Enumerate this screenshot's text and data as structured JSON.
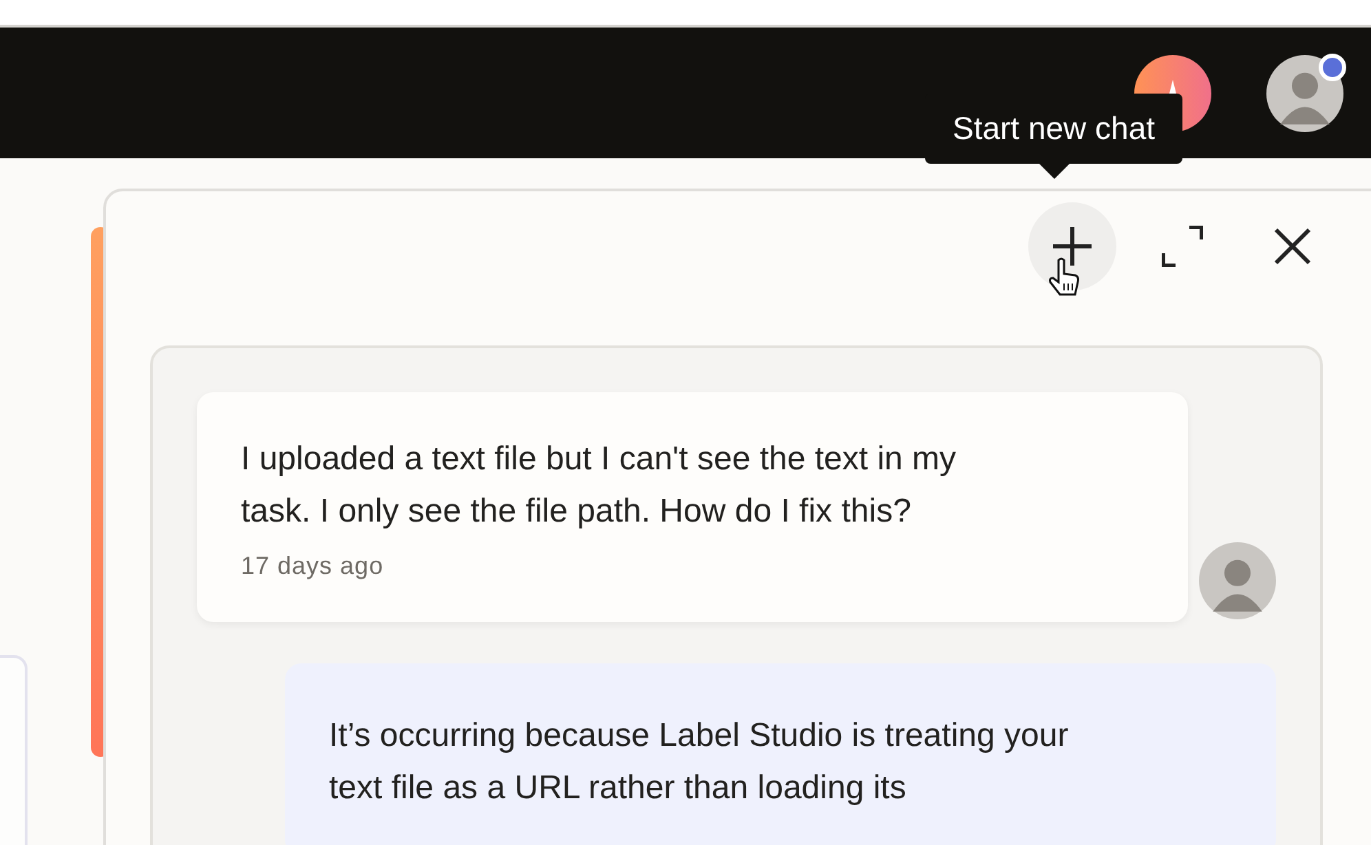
{
  "header": {
    "notification": true
  },
  "tooltip": {
    "text": "Start new chat"
  },
  "chat_panel": {
    "buttons": [
      {
        "kind": "new",
        "hovered": true
      },
      {
        "kind": "expand",
        "hovered": false
      },
      {
        "kind": "close",
        "hovered": false
      }
    ],
    "messages": [
      {
        "kind": "user",
        "text": "I uploaded a text file but I can't see the text in my task. I only see the file path. How do I fix this?",
        "time": "17 days ago"
      },
      {
        "kind": "assistant",
        "text": "It’s occurring because Label Studio is treating your text file as a URL rather than loading its"
      }
    ]
  }
}
